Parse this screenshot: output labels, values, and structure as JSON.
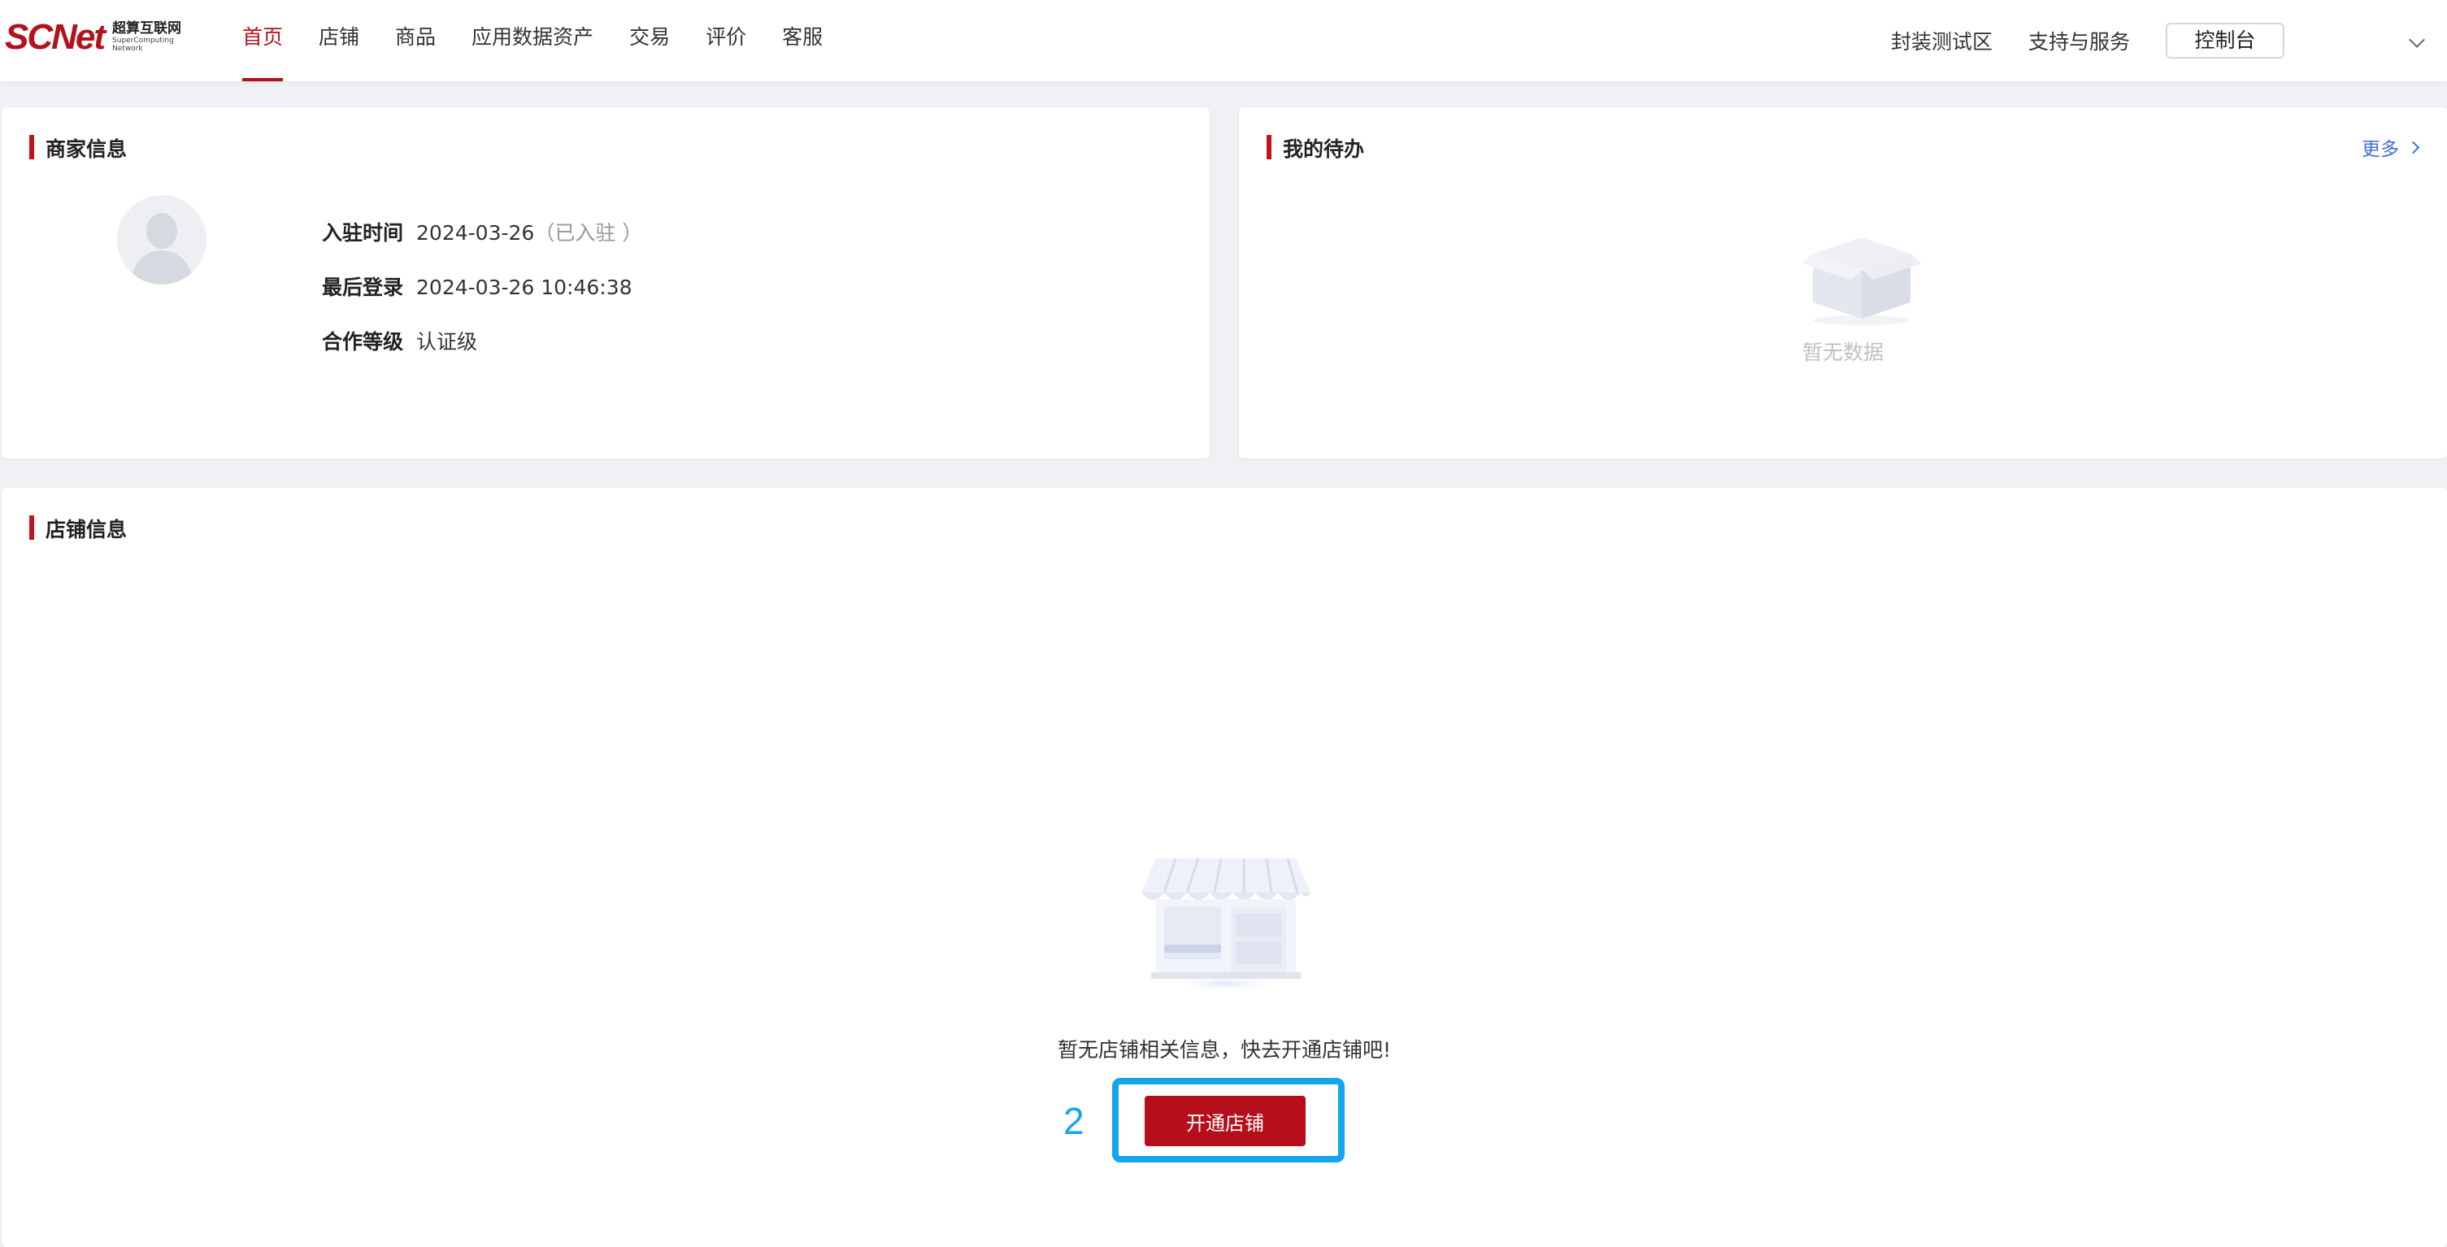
{
  "header": {
    "logo_mark": "SCNet",
    "logo_cn": "超算互联网",
    "logo_en": "SuperComputing Network",
    "nav": [
      {
        "label": "首页",
        "active": true
      },
      {
        "label": "店铺",
        "active": false
      },
      {
        "label": "商品",
        "active": false
      },
      {
        "label": "应用数据资产",
        "active": false
      },
      {
        "label": "交易",
        "active": false
      },
      {
        "label": "评价",
        "active": false
      },
      {
        "label": "客服",
        "active": false
      }
    ],
    "right_links": [
      "封装测试区",
      "支持与服务"
    ],
    "console_label": "控制台"
  },
  "merchant": {
    "title": "商家信息",
    "rows": [
      {
        "label": "入驻时间",
        "value": "2024-03-26",
        "note": "（已入驻 ）"
      },
      {
        "label": "最后登录",
        "value": "2024-03-26 10:46:38",
        "note": ""
      },
      {
        "label": "合作等级",
        "value": "认证级",
        "note": ""
      }
    ]
  },
  "todo": {
    "title": "我的待办",
    "more_label": "更多",
    "empty_text": "暂无数据"
  },
  "store": {
    "title": "店铺信息",
    "empty_text": "暂无店铺相关信息，快去开通店铺吧!",
    "open_button": "开通店铺",
    "step_number": "2"
  },
  "colors": {
    "brand": "#b3121c",
    "link": "#3d6fd6",
    "highlight": "#13a5ee"
  }
}
